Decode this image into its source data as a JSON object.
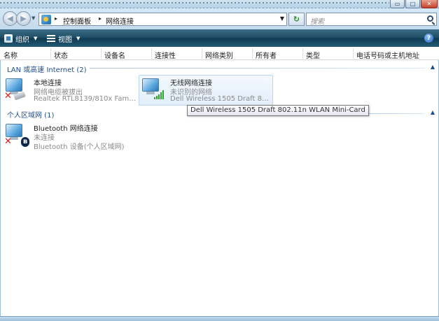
{
  "window": {
    "caption_buttons": [
      {
        "name": "minimize",
        "glyph": "▭"
      },
      {
        "name": "maximize",
        "glyph": "□"
      },
      {
        "name": "close",
        "glyph": "✕"
      }
    ]
  },
  "address": {
    "back_glyph": "◀",
    "forward_glyph": "▶",
    "crumb_separator": "▸",
    "breadcrumbs": [
      "控制面板",
      "网络连接"
    ],
    "dropdown_glyph": "▼",
    "refresh_glyph": "↻",
    "search_placeholder": "搜索"
  },
  "toolbar": {
    "organize_label": "组织",
    "views_label": "视图",
    "dropdown_glyph": "▼",
    "help_glyph": "?"
  },
  "columns": [
    "名称",
    "状态",
    "设备名",
    "连接性",
    "网络类别",
    "所有者",
    "类型",
    "电话号码或主机地址"
  ],
  "groups": [
    {
      "title": "LAN 或高速 Internet (2)",
      "collapse_glyph": "▲",
      "items": [
        {
          "name": "本地连接",
          "status": "网络电缆被拔出",
          "device": "Realtek RTL8139/810x Family...",
          "icon": "ethernet-disconnected-icon"
        },
        {
          "name": "无线网络连接",
          "status": "未识别的网络",
          "device": "Dell Wireless 1505 Draft 802....",
          "icon": "wireless-connected-icon"
        }
      ]
    },
    {
      "title": "个人区域网 (1)",
      "collapse_glyph": "▲",
      "items": [
        {
          "name": "Bluetooth 网络连接",
          "status": "未连接",
          "device": "Bluetooth 设备(个人区域网)",
          "icon": "bluetooth-disconnected-icon"
        }
      ]
    }
  ],
  "tooltip": {
    "text": "Dell Wireless 1505 Draft 802.11n WLAN Mini-Card"
  },
  "colors": {
    "toolbar_dark": "#1d4b64",
    "group_title": "#1e4e8c",
    "secondary_text": "#8a8a8a",
    "disconnected_x": "#d8231c",
    "signal_green": "#2fa52f"
  }
}
